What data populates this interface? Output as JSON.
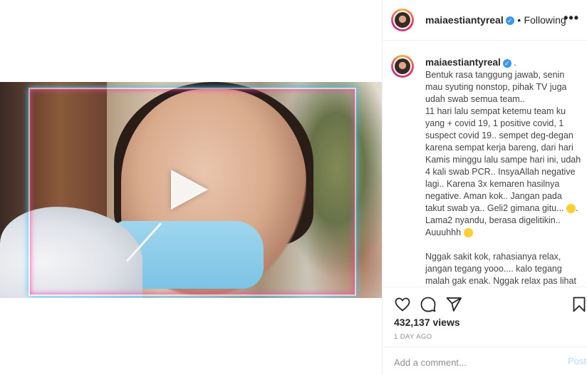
{
  "header": {
    "username": "maiaestiantyreal",
    "separator": "•",
    "follow_status": "Following",
    "more_label": "•••"
  },
  "caption": {
    "username": "maiaestiantyreal",
    "suffix": ".",
    "text_part1": "Bentuk rasa tanggung jawab, senin mau syuting nonstop, pihak TV juga udah swab semua team..\n11 hari lalu sempat ketemu team ku yang + covid 19, 1 positive covid, 1 suspect covid 19.. sempet deg-degan karena sempat kerja bareng, dari hari Kamis minggu lalu sampe hari ini, udah 4 kali swab PCR.. InsyaAllah negative lagi.. Karena 3x kemaren hasilnya negative. Aman kok.. Jangan pada takut swab ya.. Geli2 gimana gitu... ",
    "text_part2": ". Lama2 nyandu, berasa digelitikin.. Auuuhhh ",
    "text_part3": "\n\nNggak sakit kok, rahasianya relax, jangan tegang yooo.... kalo tegang malah gak enak. Nggak relax pas lihat bill bayarnya kalo satu kantor ama"
  },
  "icons": {
    "like": "heart-icon",
    "comment": "comment-icon",
    "share": "share-icon",
    "save": "bookmark-icon"
  },
  "stats": {
    "views": "432,137 views",
    "time_ago": "1 DAY AGO"
  },
  "comment_box": {
    "placeholder": "Add a comment...",
    "post_label": "Post"
  },
  "colors": {
    "verified": "#3897f0",
    "post_disabled": "#b2dffc",
    "muted": "#8e8e8e"
  }
}
